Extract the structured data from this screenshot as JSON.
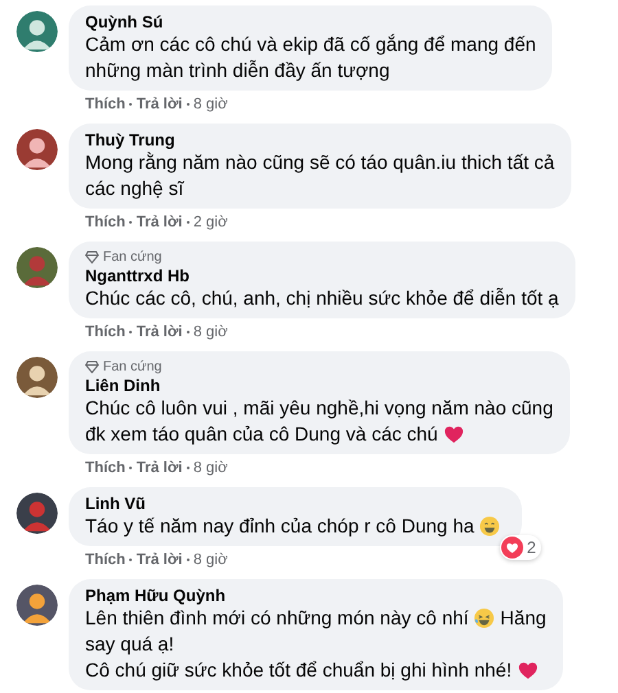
{
  "comments": [
    {
      "author": "Quỳnh Sú",
      "lines": [
        [
          {
            "kind": "text",
            "text": "Cảm ơn các cô chú và ekip đã cố gắng để mang đến"
          }
        ],
        [
          {
            "kind": "text",
            "text": "những màn trình diễn đầy ấn tượng"
          }
        ]
      ],
      "actions": [
        "Thích",
        "Trả lời"
      ],
      "time": "8 giờ"
    },
    {
      "author": "Thuỳ Trung",
      "lines": [
        [
          {
            "kind": "text",
            "text": "Mong rằng năm nào cũng sẽ có táo quân.iu thich tất cả"
          }
        ],
        [
          {
            "kind": "text",
            "text": "các nghệ sĩ"
          }
        ]
      ],
      "actions": [
        "Thích",
        "Trả lời"
      ],
      "time": "2 giờ"
    },
    {
      "author": "Nganttrxd Hb",
      "badge": "Fan cứng",
      "lines": [
        [
          {
            "kind": "text",
            "text": "Chúc các cô, chú, anh, chị nhiều sức khỏe để diễn tốt ạ"
          }
        ]
      ],
      "actions": [
        "Thích",
        "Trả lời"
      ],
      "time": "8 giờ"
    },
    {
      "author": "Liên Dinh",
      "badge": "Fan cứng",
      "lines": [
        [
          {
            "kind": "text",
            "text": "Chúc cô luôn vui , mãi yêu nghề,hi vọng năm nào cũng"
          }
        ],
        [
          {
            "kind": "text",
            "text": "đk xem táo quân của cô Dung và các chú"
          },
          {
            "kind": "heart"
          }
        ]
      ],
      "actions": [
        "Thích",
        "Trả lời"
      ],
      "time": "8 giờ"
    },
    {
      "author": "Linh Vũ",
      "lines": [
        [
          {
            "kind": "text",
            "text": "Táo y tế năm nay đỉnh của chóp r cô Dung ha"
          },
          {
            "kind": "grin"
          }
        ]
      ],
      "reactions": "2",
      "actions": [
        "Thích",
        "Trả lời"
      ],
      "time": "8 giờ"
    },
    {
      "author": "Phạm Hữu Quỳnh",
      "lines": [
        [
          {
            "kind": "text",
            "text": "Lên thiên đình mới có những món này cô nhí"
          },
          {
            "kind": "laugh"
          },
          {
            "kind": "text",
            "text": "Hăng"
          }
        ],
        [
          {
            "kind": "text",
            "text": "say quá ạ!"
          }
        ],
        [
          {
            "kind": "text",
            "text": "Cô chú giữ sức khỏe tốt để chuẩn bị ghi hình nhé!"
          },
          {
            "kind": "heart"
          }
        ]
      ]
    }
  ]
}
